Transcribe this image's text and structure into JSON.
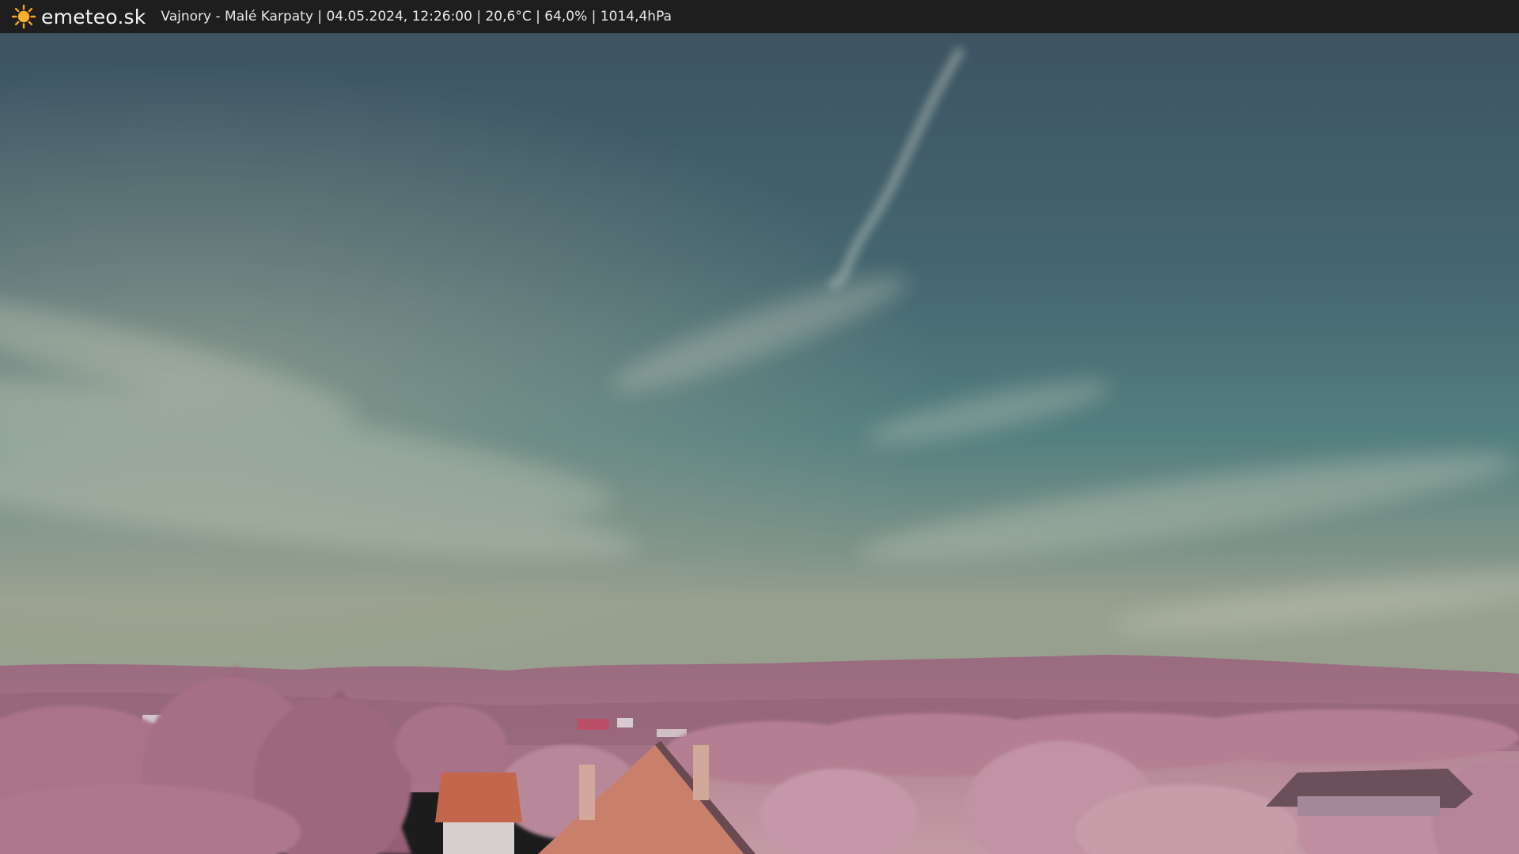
{
  "brand": {
    "name": "emeteo.sk",
    "icon": "sun-icon",
    "icon_color": "#f5a623"
  },
  "caption": {
    "location": "Vajnory - Malé Karpaty",
    "datetime": "04.05.2024, 12:26:00",
    "temperature": "20,6°C",
    "humidity": "64,0%",
    "pressure": "1014,4hPa",
    "separator": " | "
  },
  "image": {
    "subject": "webcam-landscape",
    "colors": {
      "sky_top": "#3f5866",
      "sky_mid": "#4f7a7e",
      "sky_horizon": "#8c9a8e",
      "hills": "#9b6a80",
      "foliage": "#b98597",
      "roof": "#c06a4e",
      "bar_background": "#1e1e1e"
    }
  }
}
